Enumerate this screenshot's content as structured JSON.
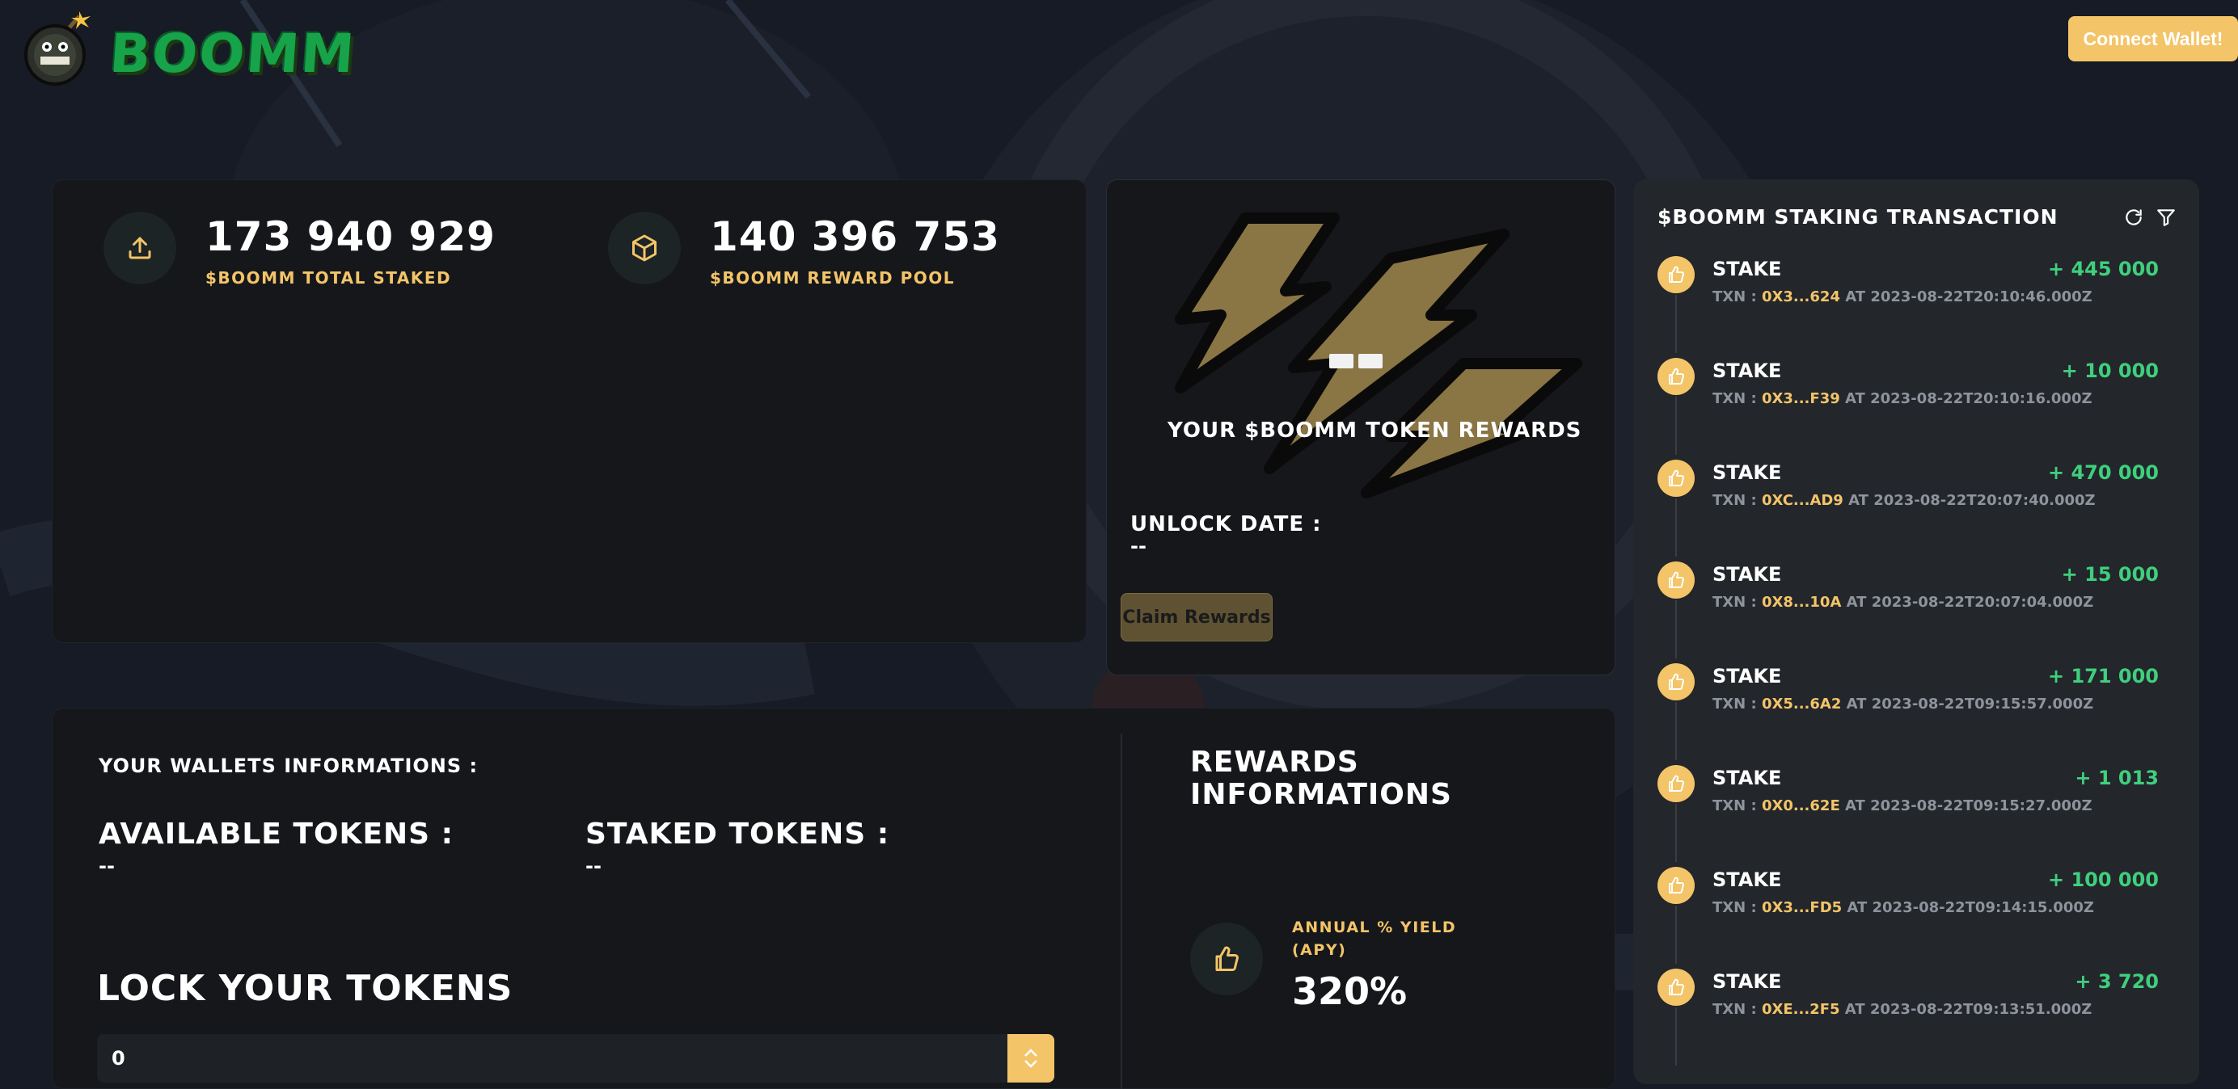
{
  "header": {
    "brand": "BOOMM",
    "connect_button": "Connect Wallet!"
  },
  "stats": {
    "total_staked_value": "173 940 929",
    "total_staked_label": "$BOOMM TOTAL STAKED",
    "reward_pool_value": "140 396 753",
    "reward_pool_label": "$BOOMM REWARD POOL"
  },
  "rewards_card": {
    "title": "YOUR $BOOMM TOKEN REWARDS",
    "unlock_label": "UNLOCK DATE :",
    "unlock_value": "--",
    "claim_button": "Claim Rewards"
  },
  "transactions": {
    "title": "$BOOMM STAKING TRANSACTION",
    "items": [
      {
        "type": "STAKE",
        "amount": "+ 445 000",
        "txn_prefix": "TXN : ",
        "hash": "0X3...624",
        "at": " AT 2023-08-22T20:10:46.000Z"
      },
      {
        "type": "STAKE",
        "amount": "+ 10 000",
        "txn_prefix": "TXN : ",
        "hash": "0X3...F39",
        "at": " AT 2023-08-22T20:10:16.000Z"
      },
      {
        "type": "STAKE",
        "amount": "+ 470 000",
        "txn_prefix": "TXN : ",
        "hash": "0XC...AD9",
        "at": " AT 2023-08-22T20:07:40.000Z"
      },
      {
        "type": "STAKE",
        "amount": "+ 15 000",
        "txn_prefix": "TXN : ",
        "hash": "0X8...10A",
        "at": " AT 2023-08-22T20:07:04.000Z"
      },
      {
        "type": "STAKE",
        "amount": "+ 171 000",
        "txn_prefix": "TXN : ",
        "hash": "0X5...6A2",
        "at": " AT 2023-08-22T09:15:57.000Z"
      },
      {
        "type": "STAKE",
        "amount": "+ 1 013",
        "txn_prefix": "TXN : ",
        "hash": "0X0...62E",
        "at": " AT 2023-08-22T09:15:27.000Z"
      },
      {
        "type": "STAKE",
        "amount": "+ 100 000",
        "txn_prefix": "TXN : ",
        "hash": "0X3...FD5",
        "at": " AT 2023-08-22T09:14:15.000Z"
      },
      {
        "type": "STAKE",
        "amount": "+ 3 720",
        "txn_prefix": "TXN : ",
        "hash": "0XE...2F5",
        "at": " AT 2023-08-22T09:13:51.000Z"
      }
    ]
  },
  "wallet": {
    "section_title": "YOUR WALLETS INFORMATIONS :",
    "available_label": "AVAILABLE TOKENS :",
    "available_value": "--",
    "staked_label": "STAKED TOKENS :",
    "staked_value": "--",
    "lock_title": "LOCK YOUR TOKENS",
    "lock_input_value": "0"
  },
  "rewards_info": {
    "title": "REWARDS INFORMATIONS",
    "apy_label": "ANNUAL % YIELD (APY)",
    "apy_value": "320%"
  },
  "colors": {
    "accent": "#f3c468",
    "positive": "#3fcf7d",
    "card": "#15171b",
    "page": "#161b25"
  }
}
